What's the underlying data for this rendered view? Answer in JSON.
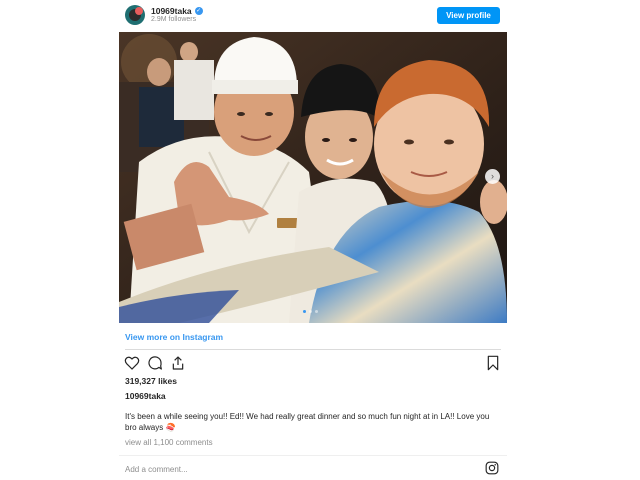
{
  "header": {
    "username": "10969taka",
    "followers": "2.9M followers",
    "view_profile_label": "View profile"
  },
  "photo": {
    "alt": "Selfie of three men at a restaurant",
    "slide_count": 3,
    "active_slide": 1
  },
  "view_more_label": "View more on Instagram",
  "actions": {
    "like_icon": "heart-icon",
    "comment_icon": "comment-icon",
    "share_icon": "share-icon",
    "save_icon": "bookmark-icon"
  },
  "likes": "319,327 likes",
  "caption": {
    "username": "10969taka",
    "text": "It's been a while seeing you!! Ed!! We had really great dinner and so much fun night at in LA!! Love you bro always",
    "emoji": "🍣"
  },
  "comments_link": "view all 1,100 comments",
  "comment_box": {
    "placeholder": "Add a comment..."
  },
  "colors": {
    "accent": "#0095f6",
    "link": "#3897f0",
    "muted": "#8e8e8e"
  }
}
